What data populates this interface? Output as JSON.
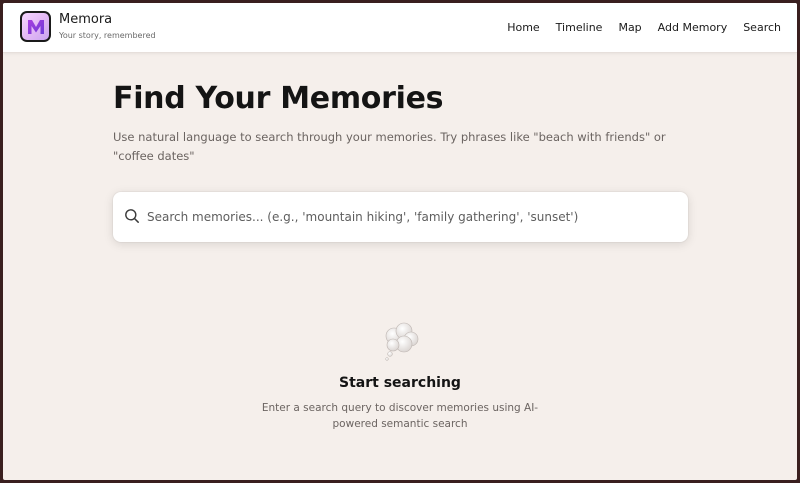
{
  "brand": {
    "name": "Memora",
    "tagline": "Your story, remembered"
  },
  "nav": {
    "items": [
      "Home",
      "Timeline",
      "Map",
      "Add Memory",
      "Search"
    ]
  },
  "page": {
    "title": "Find Your Memories",
    "subtitle": "Use natural language to search through your memories. Try phrases like \"beach with friends\" or \"coffee dates\""
  },
  "search": {
    "value": "",
    "placeholder": "Search memories... (e.g., 'mountain hiking', 'family gathering', 'sunset')"
  },
  "empty_state": {
    "icon": "thought-bubble-icon",
    "title": "Start searching",
    "description": "Enter a search query to discover memories using AI-powered semantic search"
  },
  "colors": {
    "background": "#f5efeb",
    "header": "#ffffff",
    "text": "#141414",
    "muted": "#6b6461",
    "logo_gradient": "#e4b9f5"
  }
}
